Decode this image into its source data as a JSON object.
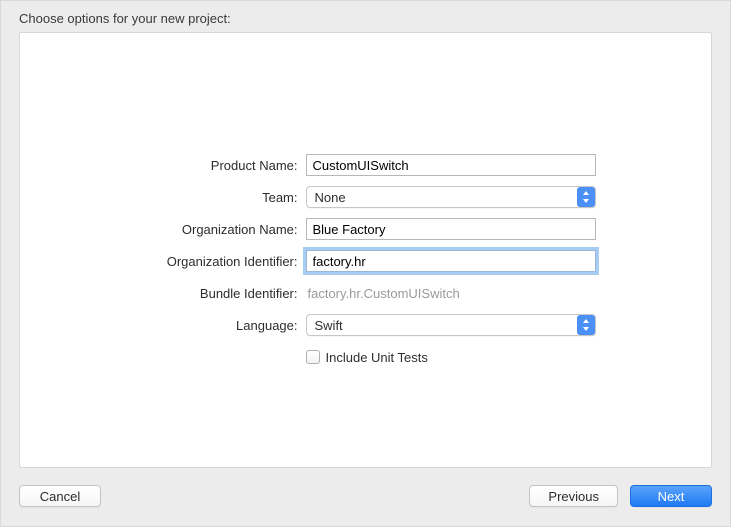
{
  "header": {
    "title": "Choose options for your new project:"
  },
  "form": {
    "product_name": {
      "label": "Product Name:",
      "value": "CustomUISwitch"
    },
    "team": {
      "label": "Team:",
      "value": "None"
    },
    "org_name": {
      "label": "Organization Name:",
      "value": "Blue Factory"
    },
    "org_identifier": {
      "label": "Organization Identifier:",
      "value": "factory.hr"
    },
    "bundle_identifier": {
      "label": "Bundle Identifier:",
      "value": "factory.hr.CustomUISwitch"
    },
    "language": {
      "label": "Language:",
      "value": "Swift"
    },
    "include_tests": {
      "label": "Include Unit Tests",
      "checked": false
    }
  },
  "footer": {
    "cancel": "Cancel",
    "previous": "Previous",
    "next": "Next"
  },
  "colors": {
    "accent": "#4a90f7",
    "panel_bg": "#ffffff",
    "window_bg": "#ececec"
  }
}
